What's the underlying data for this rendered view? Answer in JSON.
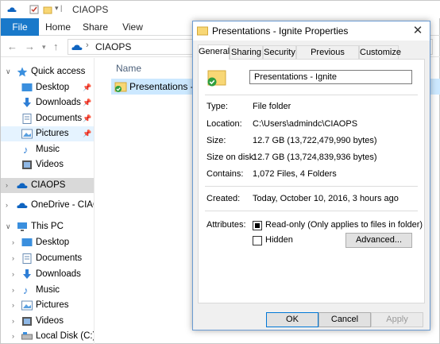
{
  "explorer": {
    "title": "CIAOPS",
    "ribbon_tabs": [
      "File",
      "Home",
      "Share",
      "View"
    ],
    "address": "CIAOPS",
    "column_header": "Name",
    "file_item": "Presentations - Igni",
    "nav": {
      "quick_access": "Quick access",
      "desktop": "Desktop",
      "downloads": "Downloads",
      "documents": "Documents",
      "pictures": "Pictures",
      "music": "Music",
      "videos": "Videos",
      "ciaops": "CIAOPS",
      "onedrive": "OneDrive - CIAOP",
      "this_pc": "This PC",
      "pc_desktop": "Desktop",
      "pc_documents": "Documents",
      "pc_downloads": "Downloads",
      "pc_music": "Music",
      "pc_pictures": "Pictures",
      "pc_videos": "Videos",
      "local_disk": "Local Disk (C:)"
    }
  },
  "dialog": {
    "title": "Presentations - Ignite Properties",
    "tabs": [
      "General",
      "Sharing",
      "Security",
      "Previous Versions",
      "Customize"
    ],
    "active_tab": "General",
    "folder_name": "Presentations - Ignite",
    "type_label": "Type:",
    "type_value": "File folder",
    "location_label": "Location:",
    "location_value": "C:\\Users\\admindc\\CIAOPS",
    "size_label": "Size:",
    "size_value": "12.7 GB (13,722,479,990 bytes)",
    "size_on_disk_label": "Size on disk:",
    "size_on_disk_value": "12.7 GB (13,724,839,936 bytes)",
    "contains_label": "Contains:",
    "contains_value": "1,072 Files, 4 Folders",
    "created_label": "Created:",
    "created_value": "Today, October 10, 2016, 3 hours ago",
    "attributes_label": "Attributes:",
    "readonly_label": "Read-only (Only applies to files in folder)",
    "hidden_label": "Hidden",
    "advanced_button": "Advanced...",
    "ok_button": "OK",
    "cancel_button": "Cancel",
    "apply_button": "Apply"
  },
  "colors": {
    "accent": "#1979ca",
    "selection": "#cce8ff",
    "folder": "#f8d775"
  }
}
